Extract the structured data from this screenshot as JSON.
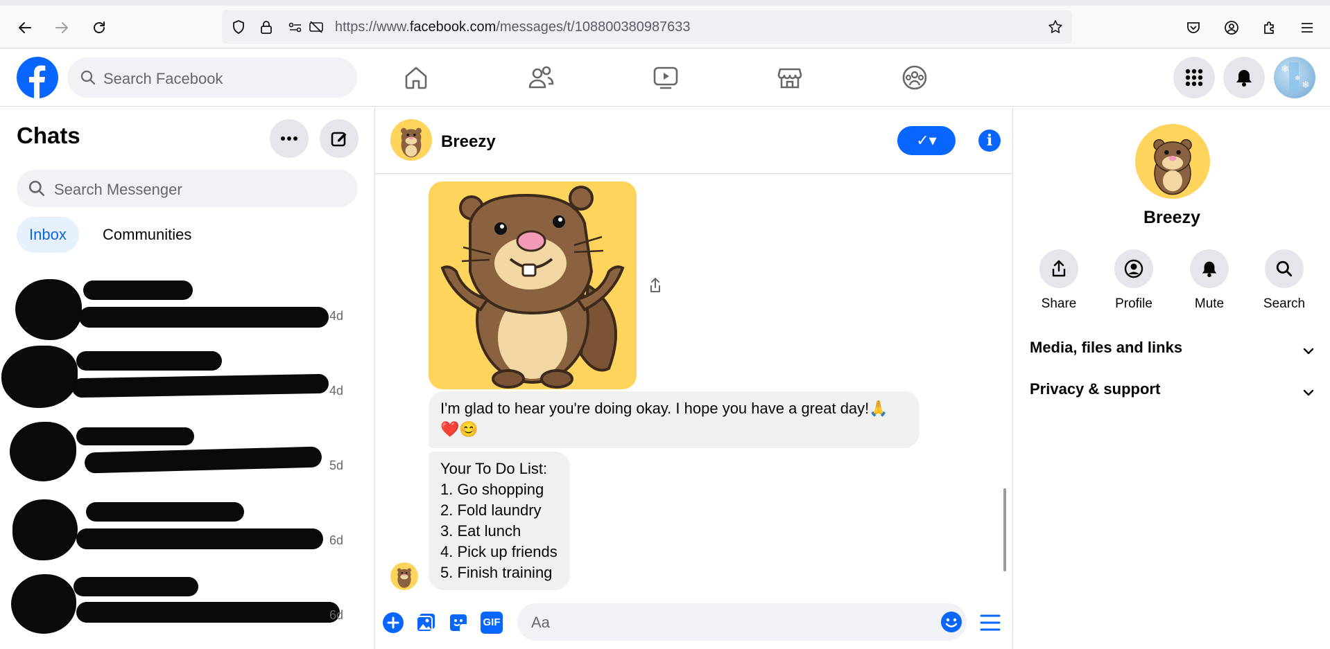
{
  "browser": {
    "url_prefix": "https://www.",
    "url_domain": "facebook.com",
    "url_path": "/messages/t/108800380987633"
  },
  "header": {
    "search_placeholder": "Search Facebook"
  },
  "chats": {
    "title": "Chats",
    "search_placeholder": "Search Messenger",
    "tabs": [
      "Inbox",
      "Communities"
    ],
    "items": [
      {
        "time": "4d"
      },
      {
        "time": "4d"
      },
      {
        "time": "5d"
      },
      {
        "time": "6d"
      },
      {
        "time": "6d"
      }
    ]
  },
  "conversation": {
    "name": "Breezy",
    "verify_glyph": "✓▾",
    "info_glyph": "i",
    "messages": [
      {
        "text": "I'm glad to hear you're doing okay. I hope you have a great day!🙏",
        "emoji_line": "❤️😊"
      },
      {
        "lines": [
          "Your To Do List:",
          "1. Go shopping",
          "2. Fold laundry",
          "3. Eat lunch",
          "4. Pick up friends",
          "5. Finish training"
        ]
      }
    ],
    "composer": {
      "placeholder": "Aa",
      "gif_label": "GIF"
    }
  },
  "details": {
    "name": "Breezy",
    "actions": [
      {
        "label": "Share",
        "icon": "share-icon"
      },
      {
        "label": "Profile",
        "icon": "profile-icon"
      },
      {
        "label": "Mute",
        "icon": "bell-icon"
      },
      {
        "label": "Search",
        "icon": "search-icon"
      }
    ],
    "sections": [
      "Media, files and links",
      "Privacy & support"
    ]
  },
  "colors": {
    "accent": "#0866ff",
    "sticker_bg": "#ffd45c"
  }
}
